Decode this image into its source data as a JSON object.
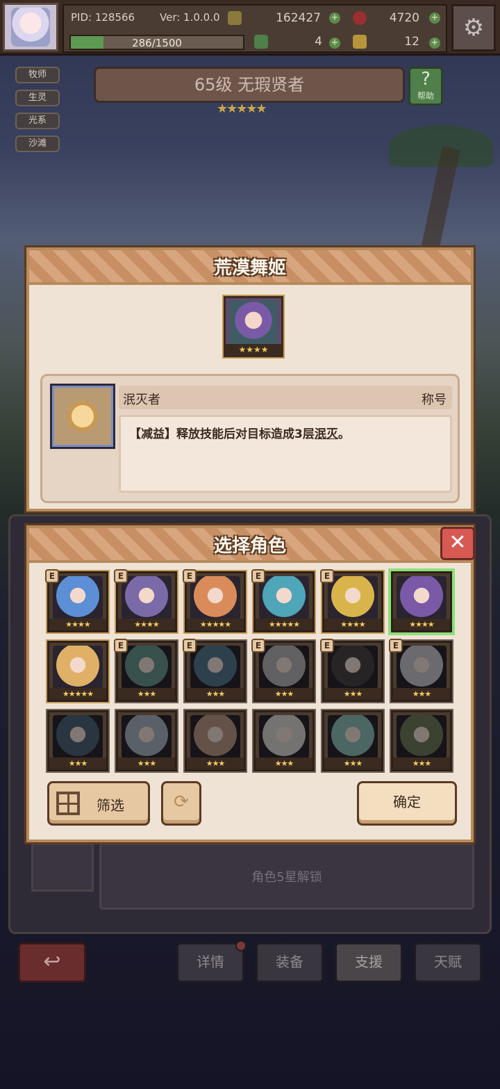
{
  "topbar": {
    "pid": "PID: 128566",
    "version": "Ver: 1.0.0.0",
    "gold": "162427",
    "gems": "4720",
    "exp": "286/1500",
    "exp_fraction": 0.19,
    "clover": "4",
    "keys": "12",
    "settings_icon": "gear-icon"
  },
  "tags": [
    "牧师",
    "生灵",
    "光系",
    "沙滩"
  ],
  "character": {
    "title": "65级 无瑕贤者",
    "stars": "★★★★★",
    "help_label": "帮助"
  },
  "skill_modal": {
    "title": "荒漠舞姬",
    "portrait_stars": "★★★★",
    "skill_name": "泯灭者",
    "skill_type": "称号",
    "desc_prefix": "【减益】释放技能后对目标造成3层",
    "desc_keyword": "泯灭",
    "desc_suffix": "。"
  },
  "select_modal": {
    "title": "选择角色",
    "close_icon": "close-icon",
    "filter_label": "筛选",
    "confirm_label": "确定",
    "refresh_icon": "refresh-icon",
    "cards": [
      {
        "stars": "★★★★",
        "badge": "E",
        "color": "#5d8fd6",
        "locked": false,
        "selected": false
      },
      {
        "stars": "★★★★",
        "badge": "E",
        "color": "#7b6aa8",
        "locked": false,
        "selected": false
      },
      {
        "stars": "★★★★★",
        "badge": "E",
        "color": "#d98c5a",
        "locked": false,
        "selected": false
      },
      {
        "stars": "★★★★★",
        "badge": "E",
        "color": "#4fa6b8",
        "locked": false,
        "selected": false
      },
      {
        "stars": "★★★★",
        "badge": "E",
        "color": "#d9b44a",
        "locked": false,
        "selected": false
      },
      {
        "stars": "★★★★",
        "badge": "",
        "color": "#7a5aa7",
        "locked": false,
        "selected": true
      },
      {
        "stars": "★★★★★",
        "badge": "",
        "color": "#e0b067",
        "locked": false,
        "selected": false
      },
      {
        "stars": "★★★",
        "badge": "E",
        "color": "#4f9a8a",
        "locked": true,
        "selected": false
      },
      {
        "stars": "★★★",
        "badge": "E",
        "color": "#3f7aa0",
        "locked": true,
        "selected": false
      },
      {
        "stars": "★★★",
        "badge": "E",
        "color": "#b0aeb4",
        "locked": true,
        "selected": false
      },
      {
        "stars": "★★★",
        "badge": "E",
        "color": "#4a4048",
        "locked": true,
        "selected": false
      },
      {
        "stars": "★★★",
        "badge": "E",
        "color": "#c4c0cc",
        "locked": true,
        "selected": false
      },
      {
        "stars": "★★★",
        "badge": "",
        "color": "#3d6488",
        "locked": true,
        "selected": false
      },
      {
        "stars": "★★★",
        "badge": "",
        "color": "#9bb0c8",
        "locked": true,
        "selected": false
      },
      {
        "stars": "★★★",
        "badge": "",
        "color": "#c99070",
        "locked": true,
        "selected": false
      },
      {
        "stars": "★★★",
        "badge": "",
        "color": "#d8cfcf",
        "locked": true,
        "selected": false
      },
      {
        "stars": "★★★",
        "badge": "",
        "color": "#6fc0b8",
        "locked": true,
        "selected": false
      },
      {
        "stars": "★★★",
        "badge": "",
        "color": "#6a7a48",
        "locked": true,
        "selected": false
      }
    ]
  },
  "under_panel": {
    "lock_text": "角色5星解锁"
  },
  "bottom_nav": {
    "back_icon": "back-arrow-icon",
    "tabs": [
      "详情",
      "装备",
      "支援",
      "天赋"
    ],
    "active_tab": "支援"
  }
}
